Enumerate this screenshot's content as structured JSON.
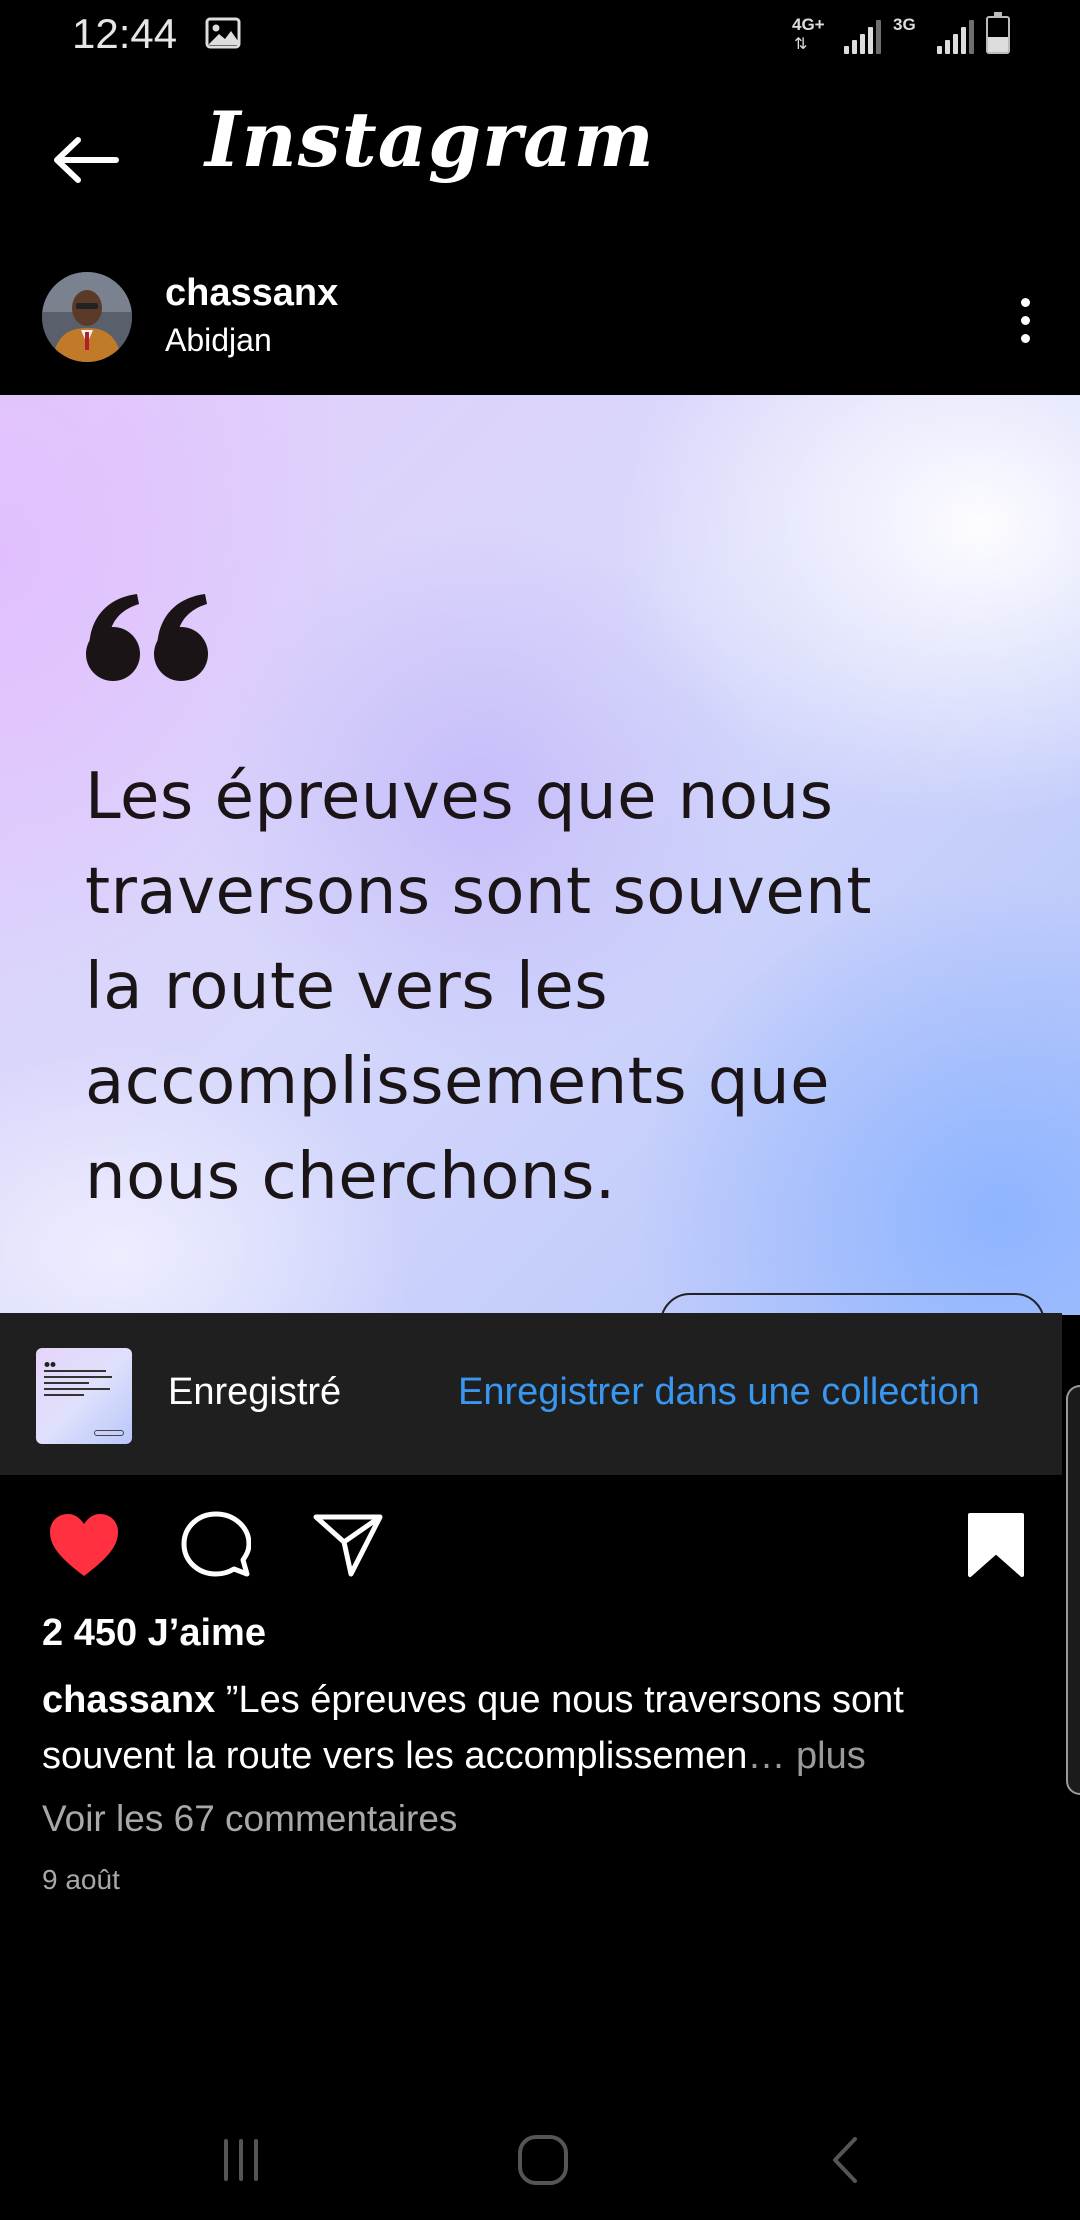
{
  "status_bar": {
    "time": "12:44",
    "network_1": "4G+",
    "network_2": "3G",
    "icons": [
      "image-icon",
      "signal-icon",
      "battery-icon"
    ]
  },
  "header": {
    "title": "Instagram",
    "back_icon": "arrow-left-icon"
  },
  "post": {
    "username": "chassanx",
    "location": "Abidjan",
    "more_icon": "more-vertical-icon",
    "image": {
      "quote_lines": [
        "Les épreuves que nous",
        "traversons sont souvent",
        "la route vers les",
        "accomplissements que",
        "nous cherchons."
      ]
    },
    "likes": "2 450 J’aime",
    "caption_user": "chassanx",
    "caption_text": " ”Les épreuves que nous traversons sont souvent la route vers les accomplissemen",
    "caption_more": "… plus",
    "comments": "Voir les 67 commentaires",
    "date": "9 août",
    "liked": true,
    "saved": true
  },
  "saved_banner": {
    "label": "Enregistré",
    "action": "Enregistrer dans une collection"
  },
  "colors": {
    "background": "#000000",
    "like": "#ff3040",
    "link": "#3897f0",
    "muted": "#a8a8a8",
    "banner": "#1f1f1f"
  }
}
